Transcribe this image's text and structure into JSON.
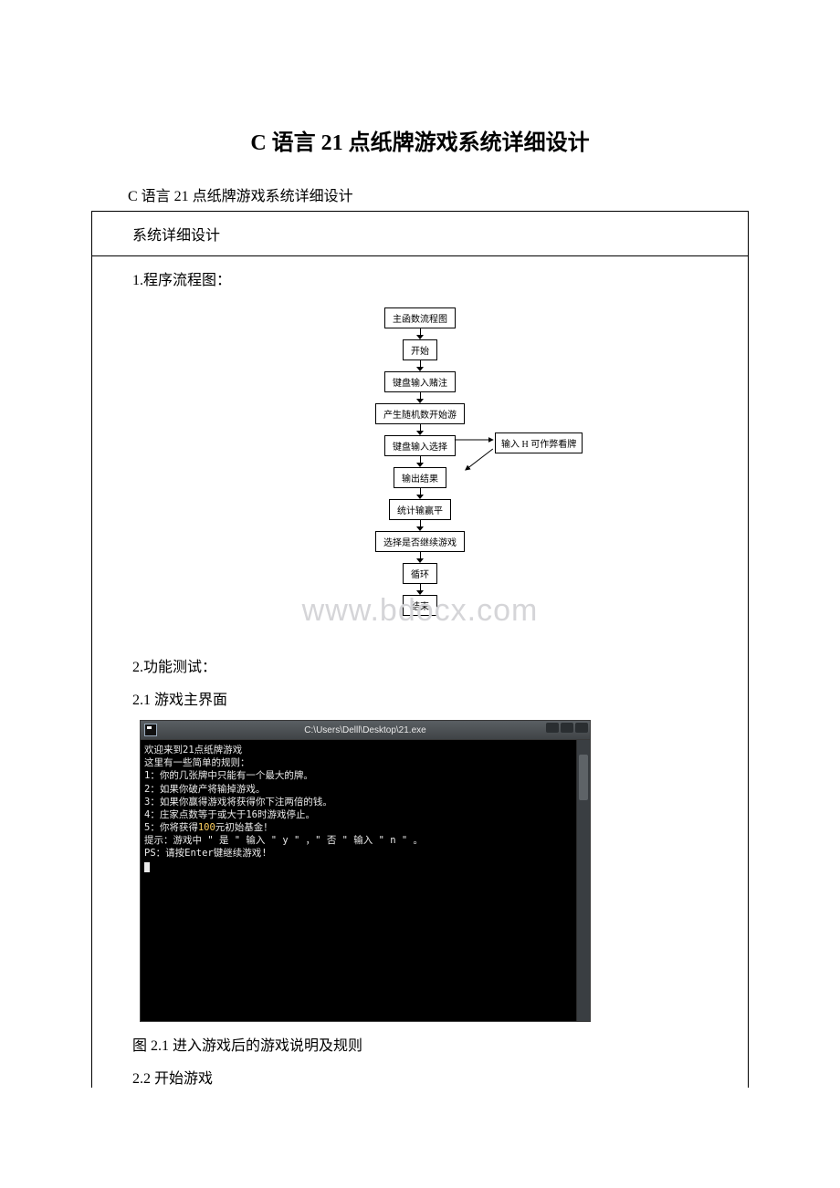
{
  "title": "C 语言 21 点纸牌游戏系统详细设计",
  "intro": "C 语言 21 点纸牌游戏系统详细设计",
  "box": {
    "header": "系统详细设计",
    "sec1": "1.程序流程图：",
    "sec2": "2.功能测试：",
    "sec2_1": "2.1 游戏主界面",
    "caption2_1": "图 2.1 进入游戏后的游戏说明及规则",
    "sec2_2": "2.2 开始游戏"
  },
  "flow": {
    "n0": "主函数流程图",
    "n1": "开始",
    "n2": "键盘输入赌注",
    "n3": "产生随机数开始游",
    "n4": "键盘输入选择",
    "side": "输入 H 可作弊看牌",
    "n5": "输出结果",
    "n6": "统计输赢平",
    "n7": "选择是否继续游戏",
    "n8": "循环",
    "n9": "结束"
  },
  "watermark": "www.bdocx.com",
  "console": {
    "title": "C:\\Users\\Delll\\Desktop\\21.exe",
    "lines": {
      "l0": "欢迎来到21点纸牌游戏",
      "l1": "这里有一些简单的规则：",
      "l2": "1：你的几张牌中只能有一个最大的牌。",
      "l3": "2：如果你破产将输掉游戏。",
      "l4": "3：如果你赢得游戏将获得你下注两倍的钱。",
      "l5": "4：庄家点数等于或大于16时游戏停止。",
      "l6a": "5：你将获得",
      "l6b": "100",
      "l6c": "元初始基金！",
      "l7": "提示：游戏中 \" 是 \" 输入 \" y \" ，\" 否 \" 输入 \" n \" 。",
      "l8": "PS：请按Enter键继续游戏!"
    }
  }
}
